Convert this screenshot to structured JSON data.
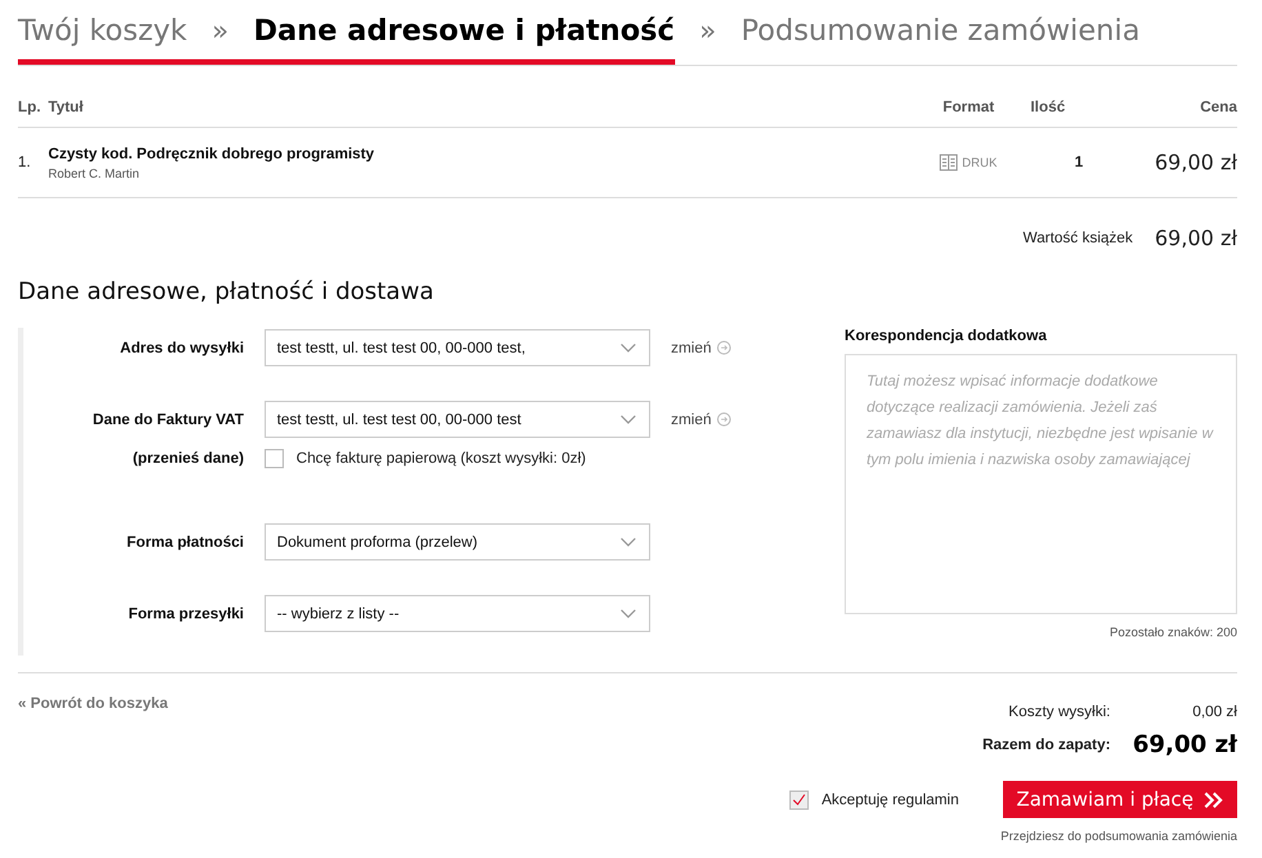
{
  "steps": {
    "separator": "»",
    "items": [
      {
        "label": "Twój koszyk",
        "selected": false
      },
      {
        "label": "Dane adresowe i płatność",
        "selected": true
      },
      {
        "label": "Podsumowanie zamówienia",
        "selected": false
      }
    ]
  },
  "cart": {
    "columns": [
      "Lp.",
      "Tytuł",
      "Format",
      "Ilość",
      "Cena"
    ],
    "rows": [
      {
        "number": "1.",
        "title": "Czysty kod. Podręcznik dobrego programisty",
        "author": "Robert C. Martin",
        "format": "DRUK",
        "quantity": "1",
        "price": "69,00 zł"
      }
    ],
    "subtotal_label": "Wartość książek",
    "subtotal": "69,00 zł"
  },
  "form": {
    "heading": "Dane adresowe, płatność i dostawa",
    "fields": [
      {
        "kind": "select",
        "label": "Adres do wysyłki",
        "value": "test testt, ul. test test 00, 00-000 test,",
        "action": "zmień"
      },
      {
        "kind": "select",
        "label": "Dane do Faktury VAT",
        "value": "test testt, ul. test test 00, 00-000 test",
        "action": "zmień"
      },
      {
        "kind": "checkbox",
        "label": "(przenieś dane)",
        "text": "Chcę fakturę papierową (koszt wysyłki: 0zł)",
        "checked": false
      },
      {
        "kind": "select",
        "label": "Forma płatności",
        "value": "Dokument proforma (przelew)"
      },
      {
        "kind": "select",
        "label": "Forma przesyłki",
        "value": "-- wybierz z listy --"
      }
    ],
    "notes": {
      "label": "Korespondencja dodatkowa",
      "placeholder": "Tutaj możesz wpisać informacje dodatkowe dotyczące realizacji zamówienia. Jeżeli zaś zamawiasz dla instytucji, niezbędne jest wpisanie w tym polu imienia i nazwiska osoby zamawiającej",
      "counter": "Pozostało znaków: 200"
    }
  },
  "footer": {
    "back": "« Powrót do koszyka",
    "shipping_label": "Koszty wysyłki:",
    "shipping": "0,00 zł",
    "total_label": "Razem do zapaty:",
    "total": "69,00 zł",
    "terms": {
      "label": "Akceptuję regulamin",
      "checked": true
    },
    "button": "Zamawiam i płacę",
    "note": "Przejdziesz do podsumowania zamówienia"
  }
}
